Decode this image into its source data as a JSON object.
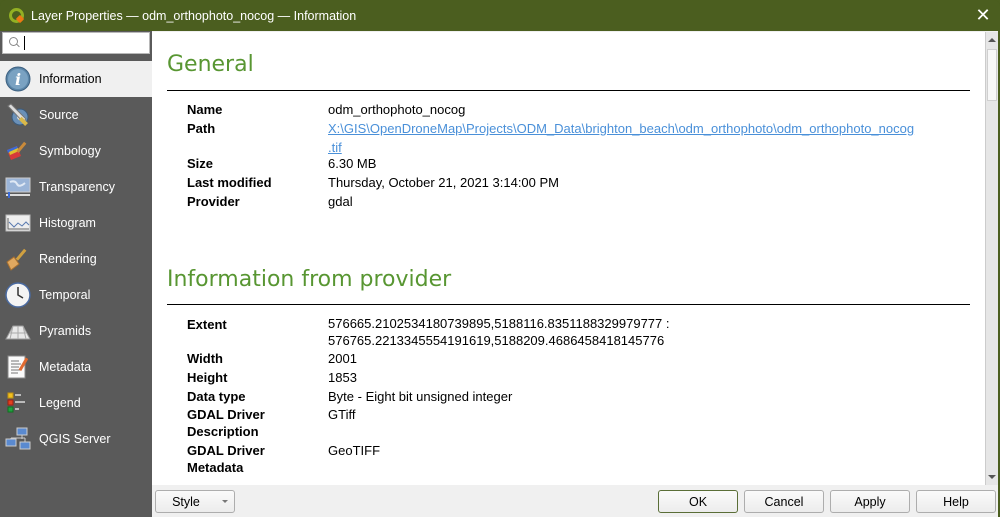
{
  "window": {
    "title": "Layer Properties — odm_orthophoto_nocog — Information",
    "close_label": "✕"
  },
  "sidebar": {
    "search": {
      "value": "",
      "placeholder": ""
    },
    "items": [
      {
        "label": "Information",
        "icon": "information-icon",
        "active": true
      },
      {
        "label": "Source",
        "icon": "source-wrench-icon",
        "active": false
      },
      {
        "label": "Symbology",
        "icon": "symbology-brush-icon",
        "active": false
      },
      {
        "label": "Transparency",
        "icon": "transparency-icon",
        "active": false
      },
      {
        "label": "Histogram",
        "icon": "histogram-icon",
        "active": false
      },
      {
        "label": "Rendering",
        "icon": "rendering-brush-icon",
        "active": false
      },
      {
        "label": "Temporal",
        "icon": "clock-icon",
        "active": false
      },
      {
        "label": "Pyramids",
        "icon": "pyramids-icon",
        "active": false
      },
      {
        "label": "Metadata",
        "icon": "metadata-document-icon",
        "active": false
      },
      {
        "label": "Legend",
        "icon": "legend-icon",
        "active": false
      },
      {
        "label": "QGIS Server",
        "icon": "server-network-icon",
        "active": false
      }
    ]
  },
  "content": {
    "general": {
      "title": "General",
      "rows": [
        {
          "key": "Name",
          "value": "odm_orthophoto_nocog"
        },
        {
          "key": "Path",
          "value": "X:\\GIS\\OpenDroneMap\\Projects\\ODM_Data\\brighton_beach\\odm_orthophoto\\odm_orthophoto_nocog",
          "value_cont": ".tif",
          "is_link": true
        },
        {
          "key": "Size",
          "value": "6.30 MB"
        },
        {
          "key": "Last modified",
          "value": "Thursday, October 21, 2021 3:14:00 PM"
        },
        {
          "key": "Provider",
          "value": "gdal"
        }
      ]
    },
    "provider": {
      "title": "Information from provider",
      "rows": [
        {
          "key": "Extent",
          "value": "576665.2102534180739895,5188116.8351188329979777 :",
          "value_cont": "576765.2213345554191619,5188209.4686458418145776"
        },
        {
          "key": "Width",
          "value": "2001"
        },
        {
          "key": "Height",
          "value": "1853"
        },
        {
          "key": "Data type",
          "value": "Byte - Eight bit unsigned integer"
        },
        {
          "key": "GDAL Driver",
          "key_cont": "Description",
          "value": "GTiff"
        },
        {
          "key": "GDAL Driver",
          "key_cont": "Metadata",
          "value": "GeoTIFF"
        }
      ]
    }
  },
  "footer": {
    "style_label": "Style",
    "ok_label": "OK",
    "cancel_label": "Cancel",
    "apply_label": "Apply",
    "help_label": "Help"
  },
  "colors": {
    "titlebar": "#4b5e1f",
    "section_title": "#589632",
    "link": "#4a90d9",
    "sidebar_bg": "#5a5a5a"
  }
}
